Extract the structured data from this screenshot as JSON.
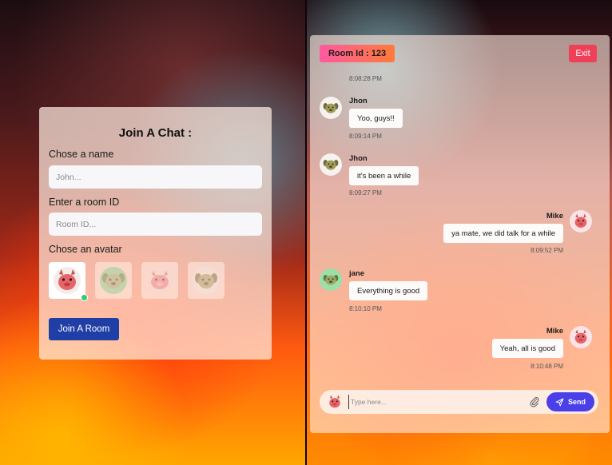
{
  "join": {
    "title": "Join A Chat :",
    "name_label": "Chose a name",
    "name_placeholder": "John...",
    "room_label": "Enter a room ID",
    "room_placeholder": "Room ID...",
    "avatar_label": "Chose an avatar",
    "avatars": [
      {
        "icon": "pink-devil-avatar-icon",
        "selected": true
      },
      {
        "icon": "green-dog-avatar-icon",
        "selected": false
      },
      {
        "icon": "pink-pig-avatar-icon",
        "selected": false
      },
      {
        "icon": "olive-dog-avatar-icon",
        "selected": false
      }
    ],
    "join_button": "Join A Room"
  },
  "chat": {
    "room_badge": "Room Id : 123",
    "exit_button": "Exit",
    "top_time": "8:08:28 PM",
    "messages": [
      {
        "sender": "Jhon",
        "text": "Yoo, guys!!",
        "time": "8:09:14 PM",
        "side": "left"
      },
      {
        "sender": "Jhon",
        "text": "it's been a while",
        "time": "8:09:27 PM",
        "side": "left"
      },
      {
        "sender": "Mike",
        "text": "ya mate, we did talk for a while",
        "time": "8:09:52 PM",
        "side": "right"
      },
      {
        "sender": "jane",
        "text": "Everything is good",
        "time": "8:10:10 PM",
        "side": "left"
      },
      {
        "sender": "Mike",
        "text": "Yeah, all is good",
        "time": "8:10:48 PM",
        "side": "right"
      }
    ],
    "composer_placeholder": "Type here...",
    "send_button": "Send"
  },
  "colors": {
    "join_button": "#1f3fa6",
    "exit_button": "#f04058",
    "send_button": "#4a3fe8",
    "online_dot": "#2ecc71"
  }
}
